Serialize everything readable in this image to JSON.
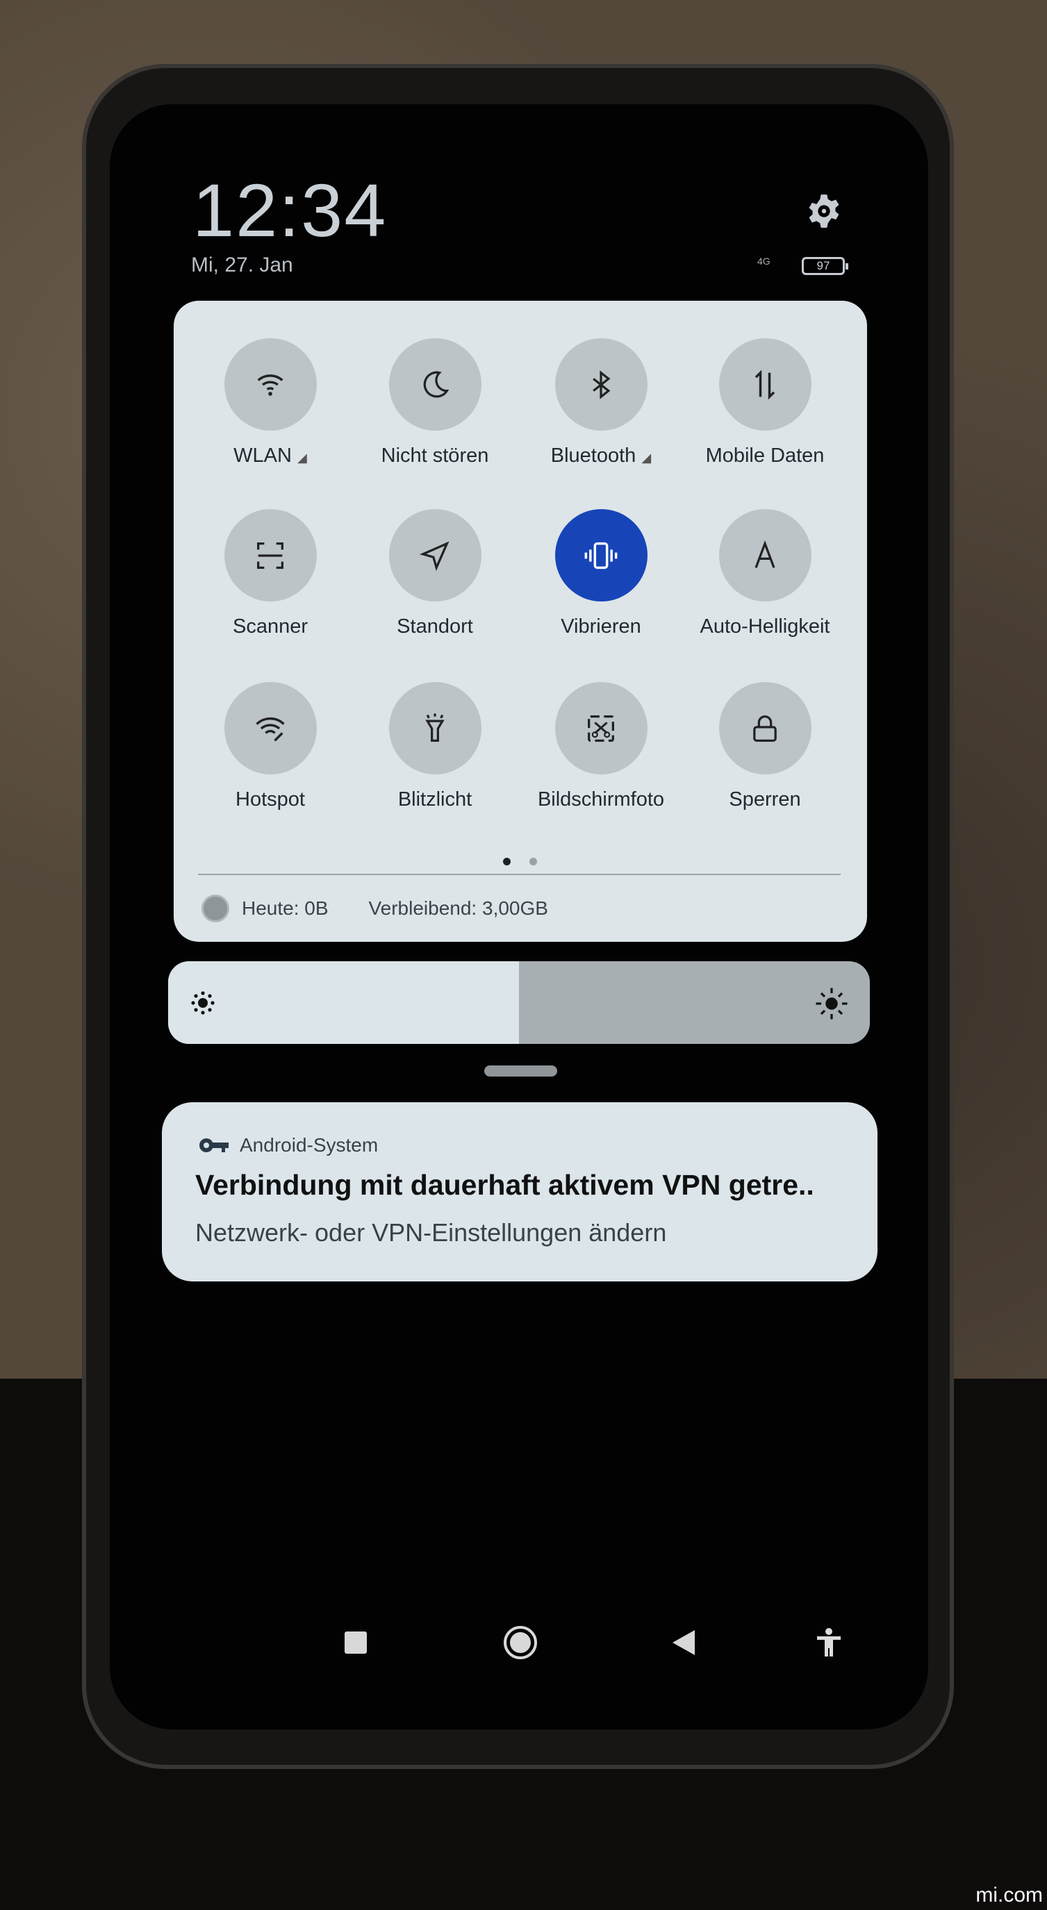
{
  "status": {
    "time": "12:34",
    "date": "Mi, 27. Jan",
    "network": "4G",
    "battery": "97"
  },
  "toggles": [
    {
      "label": "WLAN",
      "icon": "wifi-icon",
      "active": false
    },
    {
      "label": "Nicht stören",
      "icon": "moon-icon",
      "active": false
    },
    {
      "label": "Bluetooth",
      "icon": "bluetooth-icon",
      "active": false
    },
    {
      "label": "Mobile Daten",
      "icon": "mobile-data-icon",
      "active": false
    },
    {
      "label": "Scanner",
      "icon": "scanner-icon",
      "active": false
    },
    {
      "label": "Standort",
      "icon": "location-icon",
      "active": false
    },
    {
      "label": "Vibrieren",
      "icon": "vibrate-icon",
      "active": true
    },
    {
      "label": "Auto-Helligkeit",
      "icon": "auto-brightness-icon",
      "active": false
    },
    {
      "label": "Hotspot",
      "icon": "hotspot-icon",
      "active": false
    },
    {
      "label": "Blitzlicht",
      "icon": "flashlight-icon",
      "active": false
    },
    {
      "label": "Bildschirmfoto",
      "icon": "screenshot-icon",
      "active": false
    },
    {
      "label": "Sperren",
      "icon": "lock-icon",
      "active": false
    }
  ],
  "usage": {
    "today": "Heute: 0B",
    "remaining": "Verbleibend: 3,00GB"
  },
  "pager": {
    "current": 1,
    "total": 2
  },
  "brightness": {
    "level": 0.5
  },
  "notification": {
    "app": "Android-System",
    "title": "Verbindung mit dauerhaft aktivem VPN getre..",
    "body": "Netzwerk- oder VPN-Einstellungen ändern"
  },
  "colors": {
    "accent": "#1745b8",
    "panel": "#dde5e9"
  },
  "watermark": "mi.com"
}
